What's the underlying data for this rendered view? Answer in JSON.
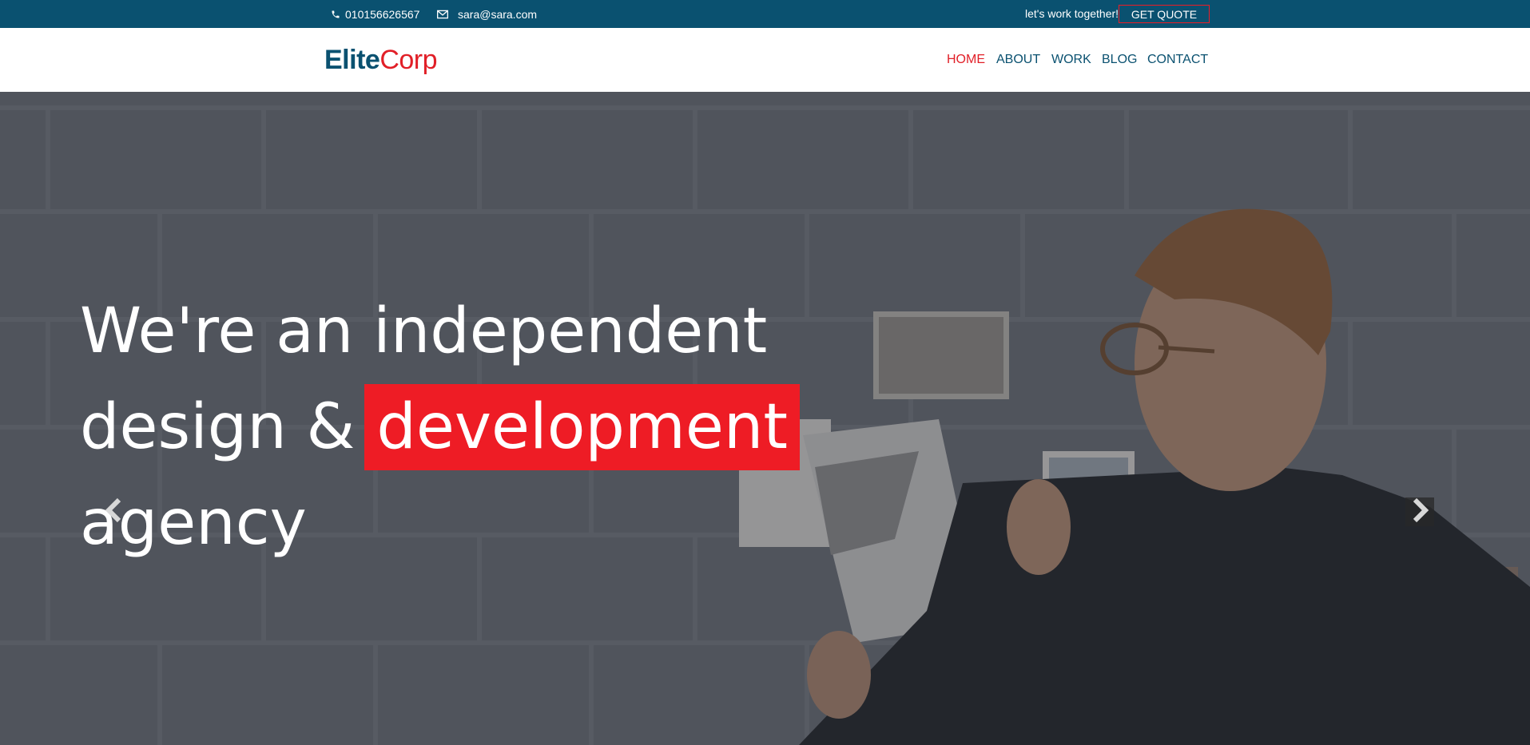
{
  "topbar": {
    "phone": "010156626567",
    "email": "sara@sara.com",
    "tagline": "let's work together!",
    "quote_button": "GET QUOTE",
    "background": "#0a5170",
    "quote_border": "#ee1c25"
  },
  "header": {
    "logo_part1": "Elite",
    "logo_part2": "Corp",
    "nav": [
      {
        "label": "HOME",
        "active": true
      },
      {
        "label": "ABOUT",
        "active": false
      },
      {
        "label": "WORK",
        "active": false
      },
      {
        "label": "BLOG",
        "active": false
      },
      {
        "label": "CONTACT",
        "active": false
      }
    ],
    "accent": "#e11f27",
    "brand": "#0a5170"
  },
  "hero": {
    "line1": "We're an independent",
    "line2_prefix": "design &",
    "line2_highlight": "development",
    "line3": "agency",
    "highlight_color": "#ee1c25",
    "prev_icon": "chevron-left-icon",
    "next_icon": "chevron-right-icon"
  }
}
